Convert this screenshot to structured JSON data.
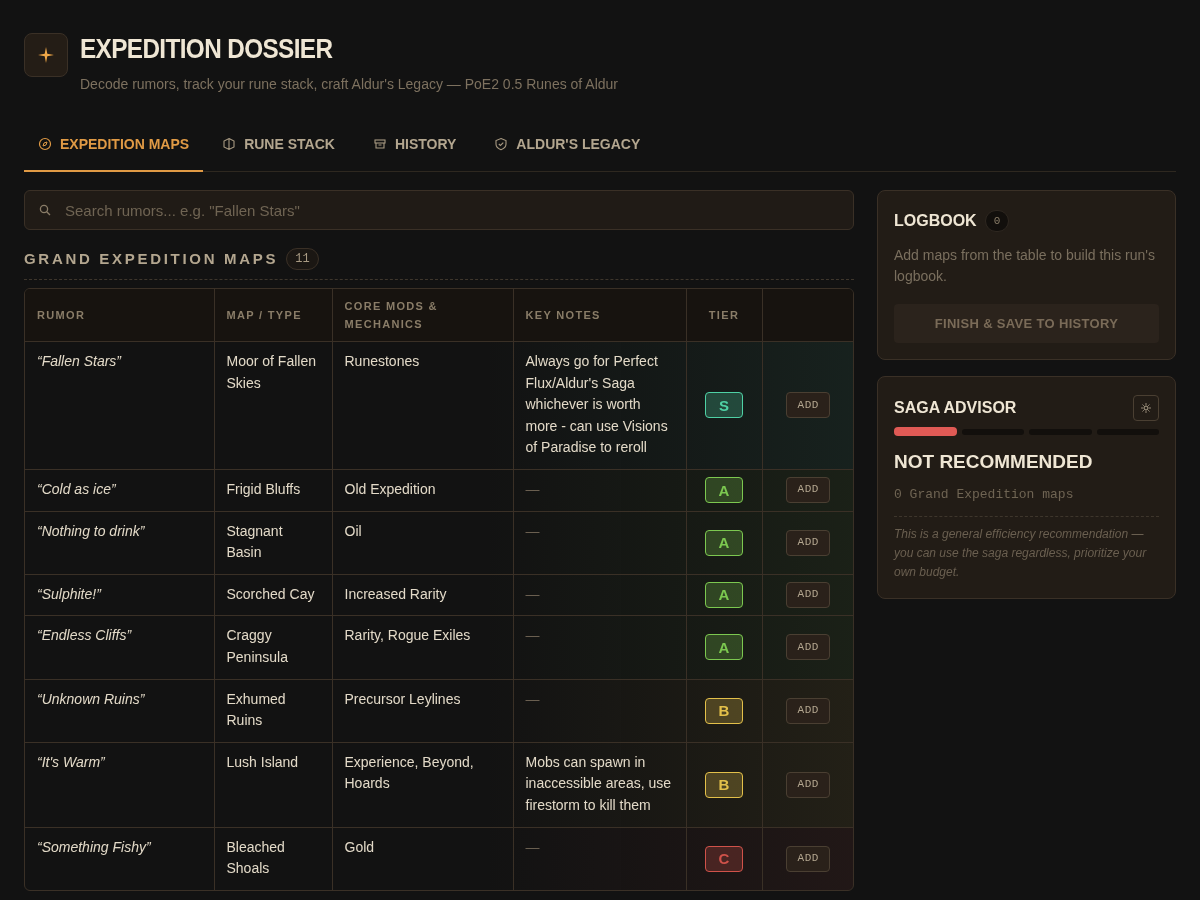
{
  "header": {
    "title": "EXPEDITION DOSSIER",
    "subtitle": "Decode rumors, track your rune stack, craft Aldur's Legacy — PoE2 0.5 Runes of Aldur"
  },
  "tabs": [
    {
      "label": "EXPEDITION MAPS",
      "kind": "compass",
      "selected": true
    },
    {
      "label": "RUNE STACK",
      "kind": "hexagon",
      "selected": false
    },
    {
      "label": "HISTORY",
      "kind": "archive",
      "selected": false
    },
    {
      "label": "ALDUR'S LEGACY",
      "kind": "shield",
      "selected": false
    }
  ],
  "search": {
    "placeholder": "Search rumors... e.g. \"Fallen Stars\""
  },
  "section": {
    "title": "GRAND EXPEDITION MAPS",
    "count": "11"
  },
  "table": {
    "columns": [
      "RUMOR",
      "MAP / TYPE",
      "CORE MODS & MECHANICS",
      "KEY NOTES",
      "TIER"
    ],
    "rows": [
      {
        "rumor": "“Fallen Stars”",
        "map": "Moor of Fallen Skies",
        "mods": "Runestones",
        "notes": "Always go for Perfect Flux/Aldur's Saga whichever is worth more - can use Visions of Paradise to reroll",
        "tier": "S",
        "color": "#4fd1a5",
        "action": "ADD"
      },
      {
        "rumor": "“Cold as ice”",
        "map": "Frigid Bluffs",
        "mods": "Old Expedition",
        "notes": "—",
        "tier": "A",
        "color": "#7cc850",
        "action": "ADD"
      },
      {
        "rumor": "“Nothing to drink”",
        "map": "Stagnant Basin",
        "mods": "Oil",
        "notes": "—",
        "tier": "A",
        "color": "#7cc850",
        "action": "ADD"
      },
      {
        "rumor": "“Sulphite!”",
        "map": "Scorched Cay",
        "mods": "Increased Rarity",
        "notes": "—",
        "tier": "A",
        "color": "#7cc850",
        "action": "ADD"
      },
      {
        "rumor": "“Endless Cliffs”",
        "map": "Craggy Peninsula",
        "mods": "Rarity, Rogue Exiles",
        "notes": "—",
        "tier": "A",
        "color": "#7cc850",
        "action": "ADD"
      },
      {
        "rumor": "“Unknown Ruins”",
        "map": "Exhumed Ruins",
        "mods": "Precursor Leylines",
        "notes": "—",
        "tier": "B",
        "color": "#e3c04a",
        "action": "ADD"
      },
      {
        "rumor": "“It's Warm”",
        "map": "Lush Island",
        "mods": "Experience, Beyond, Hoards",
        "notes": "Mobs can spawn in inaccessible areas, use firestorm to kill them",
        "tier": "B",
        "color": "#e3c04a",
        "action": "ADD"
      },
      {
        "rumor": "“Something Fishy”",
        "map": "Bleached Shoals",
        "mods": "Gold",
        "notes": "—",
        "tier": "C",
        "color": "#d0524a",
        "action": "ADD"
      }
    ]
  },
  "logbook": {
    "title": "LOGBOOK",
    "count": "0",
    "text": "Add maps from the table to build this run's logbook.",
    "button": "FINISH & SAVE TO HISTORY",
    "disabled": true
  },
  "advisor": {
    "title": "SAGA ADVISOR",
    "level": 0.25,
    "verdict": "NOT RECOMMENDED",
    "maps": "0 Grand Expedition maps",
    "note": "This is a general efficiency recommendation — you can use the saga regardless, prioritize your own budget."
  }
}
